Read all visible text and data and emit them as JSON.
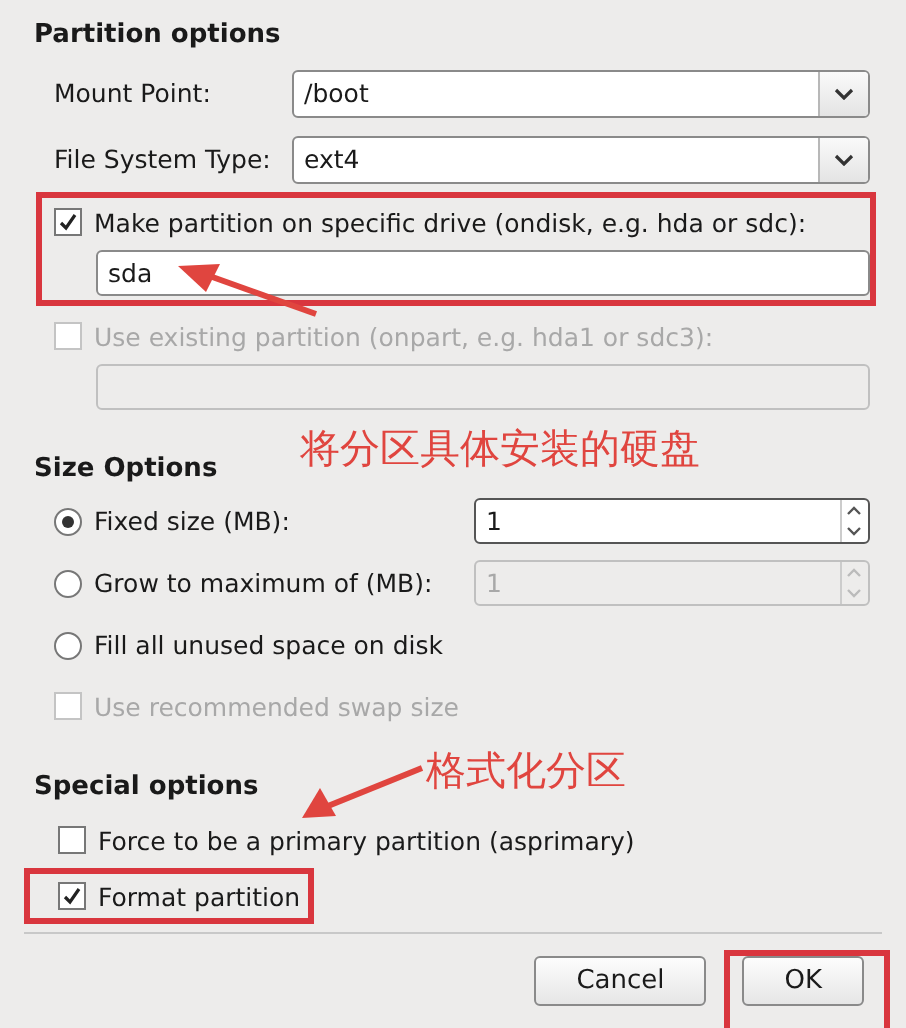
{
  "partition_options": {
    "title": "Partition options",
    "mount_point": {
      "label": "Mount Point:",
      "value": "/boot"
    },
    "fs_type": {
      "label": "File System Type:",
      "value": "ext4"
    },
    "ondisk": {
      "label": "Make partition on specific drive (ondisk, e.g. hda or sdc):",
      "checked": true,
      "disabled": false,
      "value": "sda",
      "highlighted": true
    },
    "onpart": {
      "label": "Use existing partition (onpart, e.g. hda1 or sdc3):",
      "checked": false,
      "disabled": true,
      "highlighted": false
    }
  },
  "size_options": {
    "title": "Size Options",
    "choices": [
      {
        "label": "Fixed size (MB):",
        "selected": true,
        "spin": {
          "value": "1",
          "disabled": false
        }
      },
      {
        "label": "Grow to maximum of (MB):",
        "selected": false,
        "spin": {
          "value": "1",
          "disabled": true
        }
      },
      {
        "label": "Fill all unused space on disk",
        "selected": false
      }
    ],
    "swap": {
      "label": "Use recommended swap size",
      "checked": false,
      "disabled": true
    }
  },
  "special_options": {
    "title": "Special options",
    "items": [
      {
        "label": "Force to be a primary partition (asprimary)",
        "checked": false,
        "highlighted": false
      },
      {
        "label": "Format partition",
        "checked": true,
        "highlighted": true
      }
    ]
  },
  "buttons": [
    {
      "label": "Cancel",
      "highlighted": false
    },
    {
      "label": "OK",
      "highlighted": true
    }
  ],
  "annotations": [
    {
      "text": "将分区具体安装的硬盘"
    },
    {
      "text": "格式化分区"
    }
  ]
}
